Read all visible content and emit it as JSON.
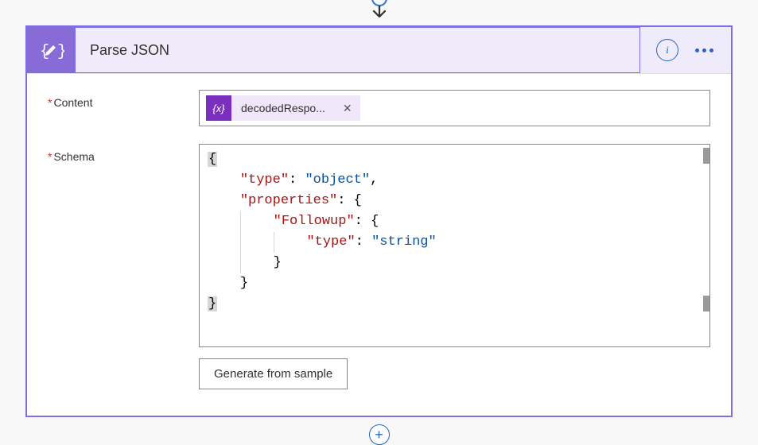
{
  "header": {
    "title": "Parse JSON",
    "info_label": "i",
    "icon_text": "{ }"
  },
  "fields": {
    "content": {
      "label": "Content",
      "token": {
        "icon": "{x}",
        "label": "decodedRespo...",
        "remove": "✕"
      }
    },
    "schema": {
      "label": "Schema",
      "code": {
        "l1_open": "{",
        "l2_key": "\"type\"",
        "l2_val": "\"object\"",
        "l3_key": "\"properties\"",
        "l4_key": "\"Followup\"",
        "l5_key": "\"type\"",
        "l5_val": "\"string\"",
        "close_brace": "}",
        "open_brace": "{",
        "colon": ":",
        "comma": ","
      }
    }
  },
  "buttons": {
    "generate": "Generate from sample",
    "add": "+"
  }
}
